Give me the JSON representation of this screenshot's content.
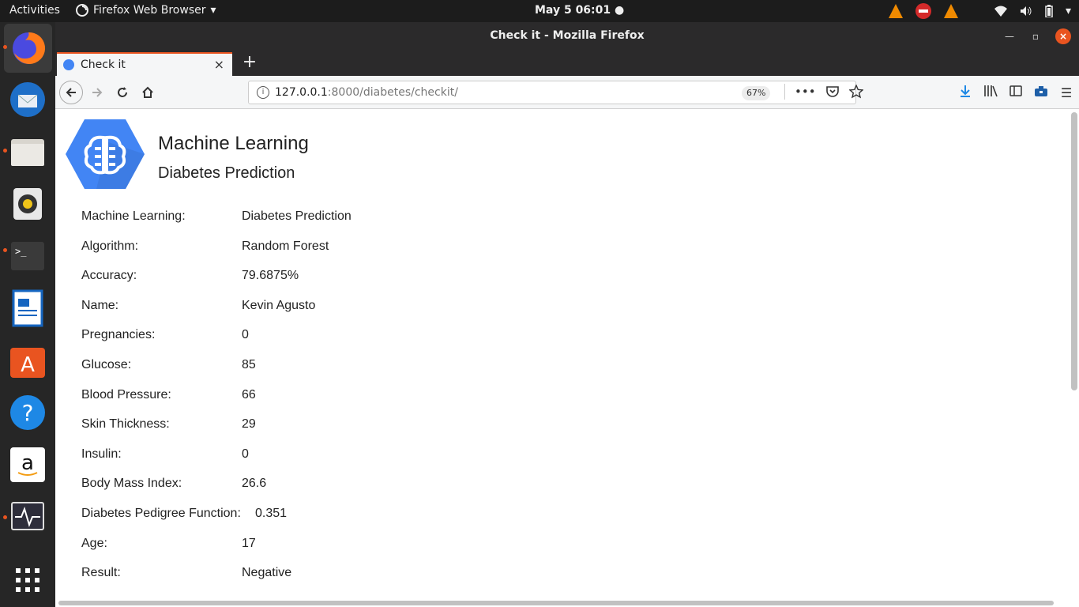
{
  "topbar": {
    "activities": "Activities",
    "app_name": "Firefox Web Browser",
    "clock": "May 5  06:01",
    "tray_icons": [
      "vlc-cone-icon",
      "no-entry-icon",
      "vlc-cone-icon",
      "wifi-icon",
      "volume-icon",
      "battery-icon",
      "dropdown-arrow-icon"
    ]
  },
  "dock": {
    "apps": [
      "firefox",
      "thunderbird",
      "files",
      "rhythmbox",
      "terminal",
      "libreoffice-writer",
      "ubuntu-software",
      "help",
      "amazon",
      "system-monitor",
      "show-applications"
    ]
  },
  "window": {
    "title": "Check it - Mozilla Firefox"
  },
  "tab": {
    "label": "Check it"
  },
  "navbar": {
    "url_host": "127.0.0.1",
    "url_rest": ":8000/diabetes/checkit/",
    "zoom": "67%"
  },
  "page": {
    "heading": "Machine Learning",
    "subheading": "Diabetes Prediction",
    "rows": [
      {
        "label": "Machine Learning:",
        "value": "Diabetes Prediction"
      },
      {
        "label": "Algorithm:",
        "value": "Random Forest"
      },
      {
        "label": "Accuracy:",
        "value": "79.6875%"
      },
      {
        "label": "Name:",
        "value": "Kevin Agusto"
      },
      {
        "label": "Pregnancies:",
        "value": "0"
      },
      {
        "label": "Glucose:",
        "value": "85"
      },
      {
        "label": "Blood Pressure:",
        "value": "66"
      },
      {
        "label": "Skin Thickness:",
        "value": "29"
      },
      {
        "label": "Insulin:",
        "value": "0"
      },
      {
        "label": "Body Mass Index:",
        "value": "26.6"
      },
      {
        "label": "Diabetes Pedigree Function:",
        "value": "0.351"
      },
      {
        "label": "Age:",
        "value": "17"
      },
      {
        "label": "Result:",
        "value": "Negative"
      }
    ]
  },
  "colors": {
    "accent": "#e95420",
    "logo_blue": "#4285f4"
  }
}
